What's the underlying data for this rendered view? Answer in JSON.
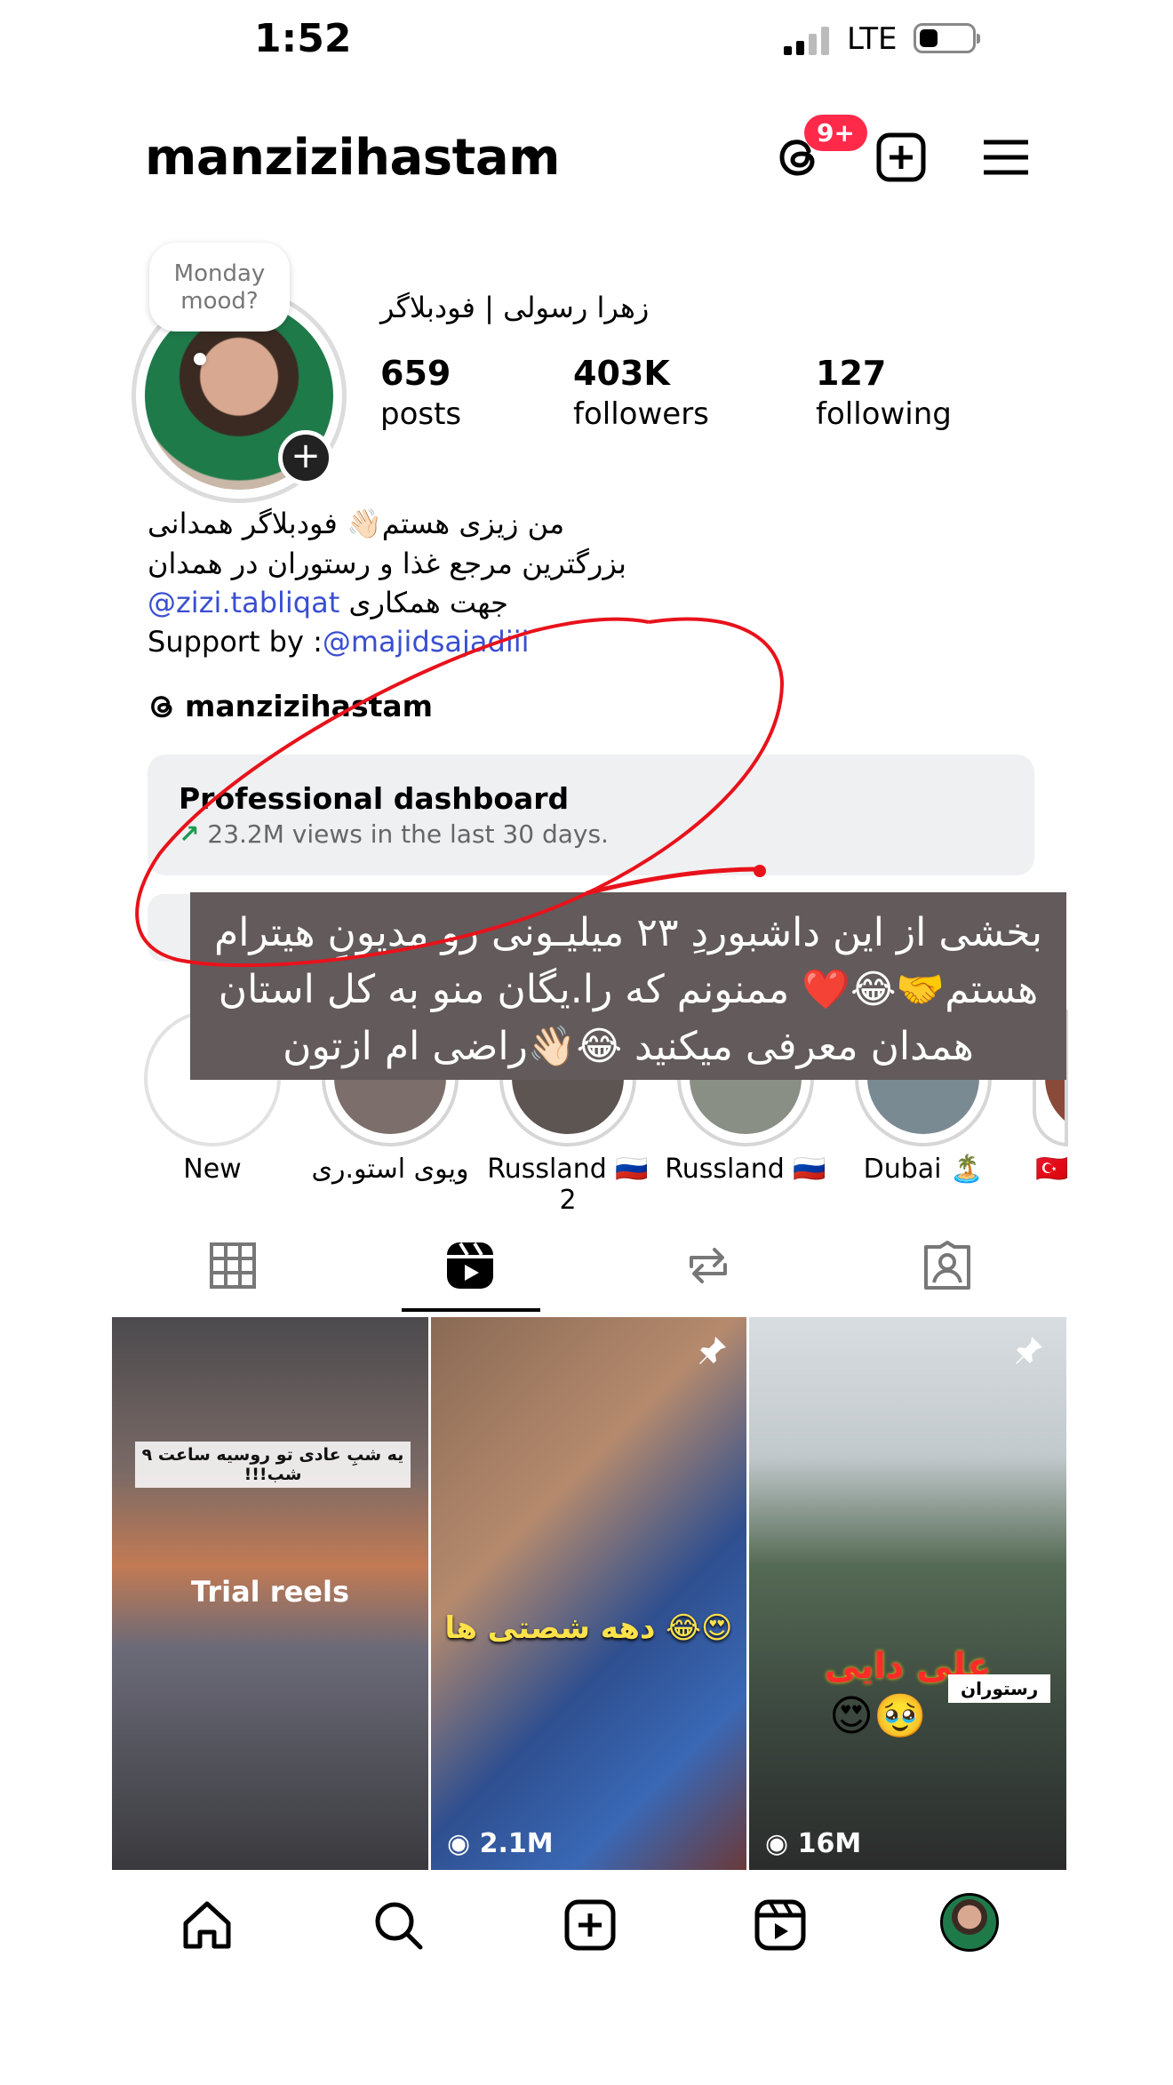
{
  "status_bar": {
    "time": "1:52",
    "network": "LTE"
  },
  "header": {
    "username": "manzizihastam",
    "notification_badge": "9+"
  },
  "profile": {
    "note": "Monday mood?",
    "full_name": "زهرا رسولی | فودبلاگر",
    "stats": [
      {
        "value": "659",
        "label": "posts"
      },
      {
        "value": "403K",
        "label": "followers"
      },
      {
        "value": "127",
        "label": "following"
      }
    ],
    "bio_line1": "من زیزی هستم👋🏻 فودبلاگر همدانی",
    "bio_line2": "بزرگترین مرجع غذا و رستوران در همدان",
    "bio_line3_text": "جهت همکاری",
    "bio_line3_link": "@zizi.tabliqat",
    "bio_line4_text": "Support by :",
    "bio_line4_link": "@majidsajadiii",
    "threads_handle": "manzizihastam"
  },
  "dashboard": {
    "title": "Professional dashboard",
    "subtitle": "23.2M views in the last 30 days."
  },
  "overlay_caption": "بخشی از این داشبوردِ ۲۳ میلیـونی رو مدیونِ هیترام هستم🤝😂❤️ ممنونم که را.یگان منو به کل استان همدان معرفی میکنید 😂👋🏻راضی ام ازتون",
  "highlights": [
    {
      "label": "New"
    },
    {
      "label": "ویوی استو.ری"
    },
    {
      "label": "Russland 🇷🇺 2"
    },
    {
      "label": "Russland 🇷🇺"
    },
    {
      "label": "Dubai 🏝️"
    },
    {
      "label": "🇹🇷"
    }
  ],
  "tabs": [
    "grid-tab",
    "reels-tab",
    "reposts-tab",
    "tagged-tab"
  ],
  "reels": [
    {
      "overlay_label": "Trial reels",
      "caption": "یه شبِ عادی تو روسیه ساعت ۹ شب!!!",
      "views": ""
    },
    {
      "caption": "😍😂 دهه شصتی ها",
      "views": "2.1M",
      "pinned": true
    },
    {
      "caption": "علی دایی",
      "sub_caption": "رستوران",
      "emojis": "😍🥹",
      "views": "16M",
      "pinned": true
    }
  ],
  "colors": {
    "accent_link": "#3a4fd1",
    "badge": "#ff2a4a",
    "annotation": "#e8121b",
    "overlay_bg": "#625a5b"
  }
}
